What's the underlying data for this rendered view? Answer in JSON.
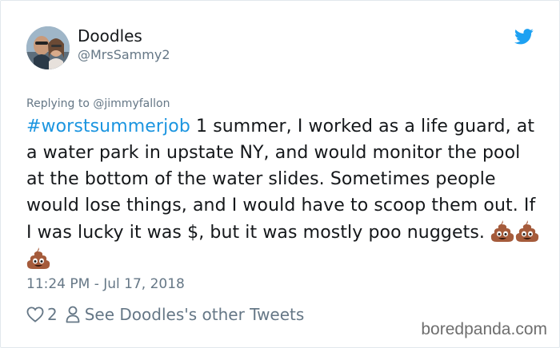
{
  "tweet": {
    "author": {
      "display_name": "Doodles",
      "handle": "@MrsSammy2"
    },
    "reply_prefix": "Replying to ",
    "reply_to": "@jimmyfallon",
    "hashtag": "#worstsummerjob",
    "body": " 1 summer, I worked as a life guard, at a water park in upstate NY, and would monitor the pool at the bottom of the water slides. Sometimes people would lose things, and I would have to scoop them out. If I was lucky it was $, but it was mostly poo nuggets. ",
    "emojis": [
      "pile-of-poo-icon",
      "pile-of-poo-icon",
      "pile-of-poo-icon"
    ],
    "timestamp": "11:24 PM - Jul 17, 2018",
    "like_count": "2",
    "profile_link": "See Doodles's other Tweets"
  },
  "watermark": "boredpanda.com",
  "colors": {
    "link": "#1b95e0",
    "muted": "#657786",
    "text": "#14171a",
    "twitter_blue": "#1da1f2"
  }
}
